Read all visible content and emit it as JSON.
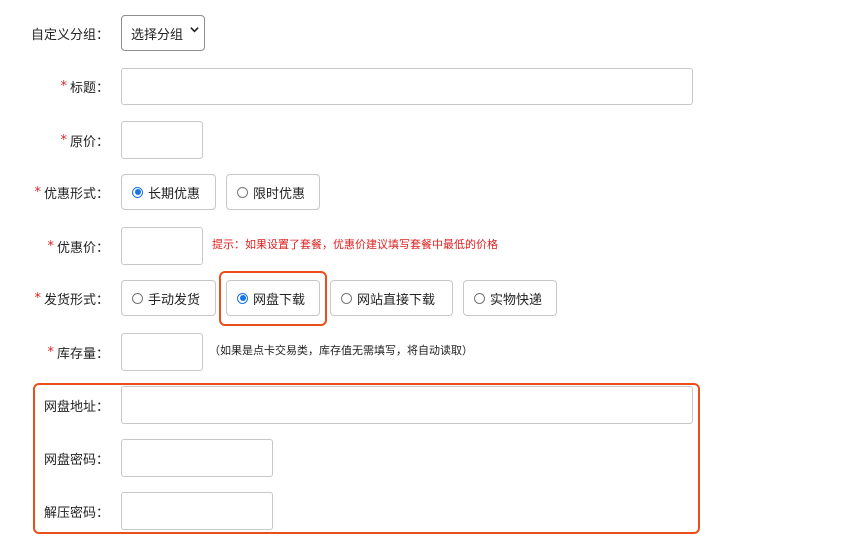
{
  "custom_group": {
    "label": "自定义分组：",
    "select_value": "选择分组"
  },
  "title_field": {
    "required_mark": "*",
    "label": "标题：",
    "value": ""
  },
  "original_price": {
    "required_mark": "*",
    "label": "原价：",
    "value": ""
  },
  "discount_type": {
    "required_mark": "*",
    "label": "优惠形式：",
    "options": [
      "长期优惠",
      "限时优惠"
    ],
    "selected": "长期优惠"
  },
  "discount_price": {
    "required_mark": "*",
    "label": "优惠价：",
    "value": "",
    "hint": "提示：如果设置了套餐，优惠价建议填写套餐中最低的价格"
  },
  "delivery_type": {
    "required_mark": "*",
    "label": "发货形式：",
    "options": [
      "手动发货",
      "网盘下载",
      "网站直接下载",
      "实物快递"
    ],
    "selected": "网盘下载"
  },
  "stock": {
    "required_mark": "*",
    "label": "库存量：",
    "value": "",
    "hint": "（如果是点卡交易类，库存值无需填写，将自动读取）"
  },
  "netdisk_url": {
    "label": "网盘地址：",
    "value": ""
  },
  "netdisk_password": {
    "label": "网盘密码：",
    "value": ""
  },
  "unzip_password": {
    "label": "解压密码：",
    "value": ""
  },
  "colors": {
    "required": "#e02020",
    "hint": "#e02020",
    "highlight": "#ea4e1b",
    "radio_selected": "#1a73e8"
  }
}
